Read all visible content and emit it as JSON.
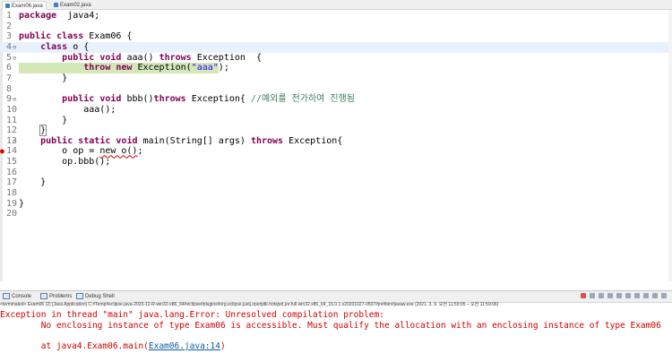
{
  "editor_tabs": [
    {
      "label": "Exam06.java",
      "active": true
    },
    {
      "label": "Exam02.java",
      "active": false
    }
  ],
  "code_lines": [
    {
      "n": "1",
      "parts": [
        [
          "kw",
          "package"
        ],
        [
          "",
          "  java4;"
        ]
      ]
    },
    {
      "n": "2",
      "parts": []
    },
    {
      "n": "3",
      "parts": [
        [
          "kw",
          "public"
        ],
        [
          "",
          " "
        ],
        [
          "kw",
          "class"
        ],
        [
          "",
          " Exam06 {"
        ]
      ]
    },
    {
      "n": "4",
      "fold": true,
      "caret": true,
      "parts": [
        [
          "",
          "    "
        ],
        [
          "kw",
          "class"
        ],
        [
          "",
          " o {"
        ]
      ]
    },
    {
      "n": "5",
      "fold": true,
      "parts": [
        [
          "",
          "        "
        ],
        [
          "kw",
          "public"
        ],
        [
          "",
          " "
        ],
        [
          "kw",
          "void"
        ],
        [
          "",
          " aaa() "
        ],
        [
          "kw",
          "throws"
        ],
        [
          "",
          " Exception  {"
        ]
      ]
    },
    {
      "n": "6",
      "highlight": true,
      "parts": [
        [
          "",
          "            "
        ],
        [
          "kw",
          "throw"
        ],
        [
          "",
          " "
        ],
        [
          "kw",
          "new"
        ],
        [
          "",
          " Exception("
        ],
        [
          "str",
          "\"aaa\""
        ],
        [
          "",
          ");"
        ]
      ]
    },
    {
      "n": "7",
      "parts": [
        [
          "",
          "        }"
        ]
      ]
    },
    {
      "n": "8",
      "parts": []
    },
    {
      "n": "9",
      "fold": true,
      "parts": [
        [
          "",
          "        "
        ],
        [
          "kw",
          "public"
        ],
        [
          "",
          " "
        ],
        [
          "kw",
          "void"
        ],
        [
          "",
          " bbb()"
        ],
        [
          "kw",
          "throws"
        ],
        [
          "",
          " Exception{ "
        ],
        [
          "cmt",
          "//예외를 전가하여 진행됨"
        ]
      ]
    },
    {
      "n": "10",
      "parts": [
        [
          "",
          "            aaa();"
        ]
      ]
    },
    {
      "n": "11",
      "parts": [
        [
          "",
          "        }"
        ]
      ]
    },
    {
      "n": "12",
      "parts": [
        [
          "",
          "    "
        ],
        [
          "bracket",
          "}"
        ]
      ]
    },
    {
      "n": "13",
      "fold": true,
      "parts": [
        [
          "",
          "    "
        ],
        [
          "kw",
          "public"
        ],
        [
          "",
          " "
        ],
        [
          "kw",
          "static"
        ],
        [
          "",
          " "
        ],
        [
          "kw",
          "void"
        ],
        [
          "",
          " main(String[] args) "
        ],
        [
          "kw",
          "throws"
        ],
        [
          "",
          " Exception{"
        ]
      ]
    },
    {
      "n": "14",
      "error": true,
      "parts": [
        [
          "",
          "        o op = "
        ],
        [
          "squig",
          "new o()"
        ],
        [
          "",
          ";"
        ]
      ]
    },
    {
      "n": "15",
      "parts": [
        [
          "",
          "        op.bbb();"
        ]
      ]
    },
    {
      "n": "16",
      "parts": []
    },
    {
      "n": "17",
      "parts": [
        [
          "",
          "    }"
        ]
      ]
    },
    {
      "n": "18",
      "parts": []
    },
    {
      "n": "19",
      "parts": [
        [
          "",
          "}"
        ]
      ]
    },
    {
      "n": "20",
      "parts": []
    }
  ],
  "console_tabs": [
    {
      "label": "Console",
      "active": true
    },
    {
      "label": "Problems",
      "active": false
    },
    {
      "label": "Debug Shell",
      "active": false
    }
  ],
  "console_status": "<terminated> Exam06 (2) [Java Application] C:#Temp#eclipse-java-2020-12-R-win32-x86_64#eclipse#plugins#org.eclipse.justj.openjdk.hotspot.jre.full.win32.x86_64_15.0.1.v20201027-0507#jre#bin#javaw.exe  (2021. 3. 9. 오전 11:59:05 – 오전 11:59:06)",
  "console_output": {
    "line1": "Exception in thread \"main\" java.lang.Error: Unresolved compilation problem:",
    "line2": "        No enclosing instance of type Exam06 is accessible. Must qualify the allocation with an enclosing instance of type Exam06",
    "line3_prefix": "        at java4.Exam06.main(",
    "line3_link": "Exam06.java:14",
    "line3_suffix": ")"
  },
  "colors": {
    "keyword": "#7f0055",
    "string": "#2a00ff",
    "comment": "#3f7f5f",
    "error": "#d00000",
    "highlight": "#d4e7b7"
  }
}
